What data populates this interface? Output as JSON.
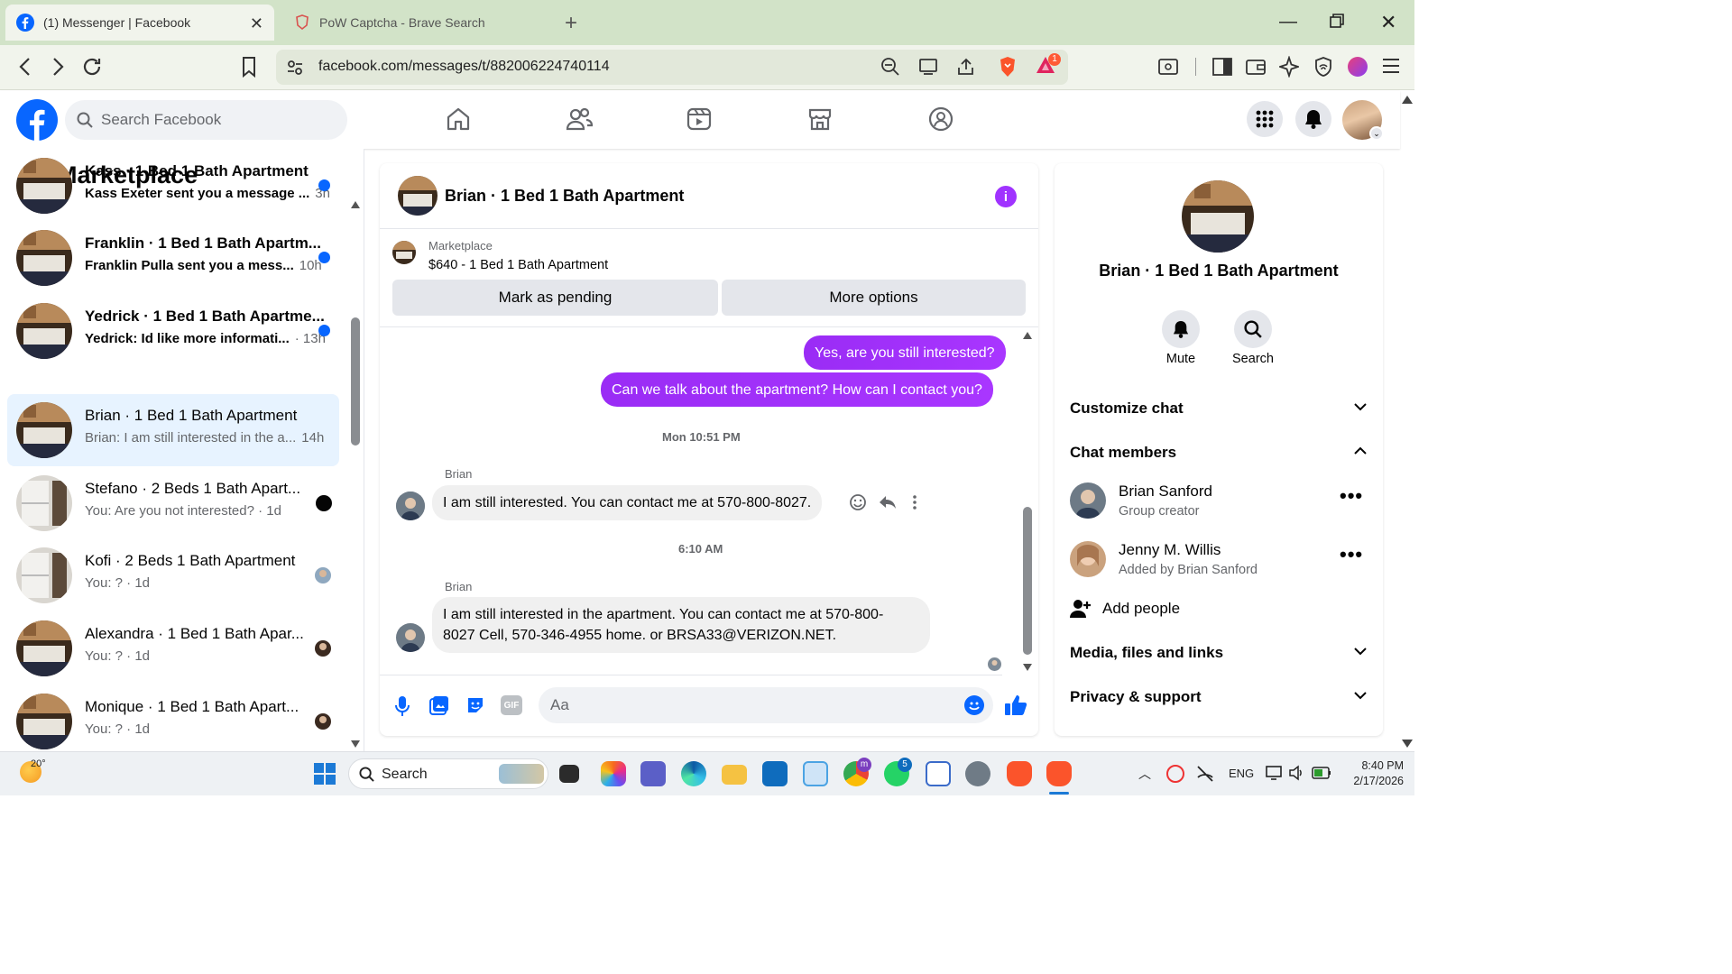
{
  "browser": {
    "tabs": [
      {
        "title": "(1) Messenger | Facebook",
        "active": true
      },
      {
        "title": "PoW Captcha - Brave Search",
        "active": false
      }
    ],
    "url": "facebook.com/messages/t/882006224740114",
    "brave_badge_count": "1"
  },
  "facebook": {
    "search_placeholder": "Search Facebook",
    "nav_icons": [
      "home-icon",
      "friends-icon",
      "video-icon",
      "marketplace-icon",
      "groups-icon"
    ],
    "accent": "#0866ff"
  },
  "left_pane": {
    "title": "Marketplace",
    "conversations": [
      {
        "name": "Kass · 1 Bed 1 Bath Apartment",
        "preview": "Kass Exeter sent you a message ...",
        "time": "3h",
        "unread": true
      },
      {
        "name": "Franklin · 1 Bed 1 Bath Apartm...",
        "preview": "Franklin Pulla sent you a mess...",
        "time": "10h",
        "unread": true
      },
      {
        "name": "Yedrick · 1 Bed 1 Bath Apartme...",
        "preview": "Yedrick: Id like more informati...",
        "time": "· 13h",
        "unread": true
      },
      {
        "name": "Brian · 1 Bed 1 Bath Apartment",
        "preview": "Brian: I am still interested in the a...",
        "time": "14h",
        "unread": false,
        "selected": true
      },
      {
        "name": "Stefano · 2 Beds 1 Bath Apart...",
        "preview": "You: Are you not interested? · 1d",
        "time": "",
        "unread": false
      },
      {
        "name": "Kofi · 2 Beds 1 Bath Apartment",
        "preview": "You: ? · 1d",
        "time": "",
        "unread": false
      },
      {
        "name": "Alexandra · 1 Bed 1 Bath Apar...",
        "preview": "You: ? · 1d",
        "time": "",
        "unread": false
      },
      {
        "name": "Monique · 1 Bed 1 Bath Apart...",
        "preview": "You: ? · 1d",
        "time": "",
        "unread": false
      }
    ]
  },
  "chat": {
    "title": "Brian · 1 Bed 1 Bath Apartment",
    "listing_source": "Marketplace",
    "listing_title": "$640 - 1 Bed 1 Bath Apartment",
    "mark_pending": "Mark as pending",
    "more_options": "More options",
    "messages_out": [
      "Yes, are you still interested?",
      "Can we talk about the apartment? How can I contact you?"
    ],
    "timestamp_1": "Mon 10:51 PM",
    "sender_1": "Brian",
    "message_in_1": "I am still interested. You can contact me at 570-800-8027.",
    "timestamp_2": "6:10 AM",
    "sender_2": "Brian",
    "message_in_2_line1": "I am still interested in the apartment. You can contact me at 570-800-",
    "message_in_2_line2": "8027 Cell, 570-346-4955 home. or BRSA33@VERIZON.NET.",
    "composer_placeholder": "Aa",
    "outgoing_color": "#a033ff"
  },
  "info_pane": {
    "title": "Brian · 1 Bed 1 Bath Apartment",
    "mute": "Mute",
    "search": "Search",
    "customize_chat": "Customize chat",
    "chat_members": "Chat members",
    "members": [
      {
        "name": "Brian Sanford",
        "role": "Group creator"
      },
      {
        "name": "Jenny M. Willis",
        "role": "Added by Brian Sanford"
      }
    ],
    "add_people": "Add people",
    "media_files": "Media, files and links",
    "privacy": "Privacy & support"
  },
  "taskbar": {
    "weather": "20°",
    "search": "Search",
    "lang": "ENG",
    "time": "8:40 PM",
    "date": "2/17/2026",
    "meet_badge": "m",
    "whatsapp_badge": "5"
  }
}
